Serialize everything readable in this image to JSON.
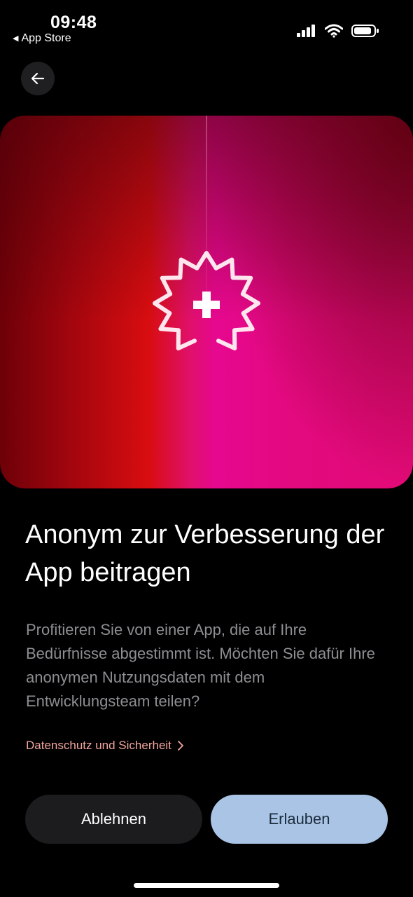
{
  "status_bar": {
    "time": "09:48",
    "back_to_app": "App Store"
  },
  "nav": {
    "back_icon": "arrow-left-icon"
  },
  "hero": {
    "icon": "seal-plus-icon",
    "colors": {
      "left": "#a5060e",
      "middle": "#e6088f",
      "right": "#e10a76"
    }
  },
  "content": {
    "title": "Anonym zur Verbesserung der App beitragen",
    "body": "Profitieren Sie von einer App, die auf Ihre Bedürfnisse abgestimmt ist. Möchten Sie dafür Ihre anonymen Nutzungsdaten mit dem Entwicklungsteam teilen?",
    "privacy_link": "Datenschutz und Sicherheit"
  },
  "actions": {
    "decline_label": "Ablehnen",
    "allow_label": "Erlauben"
  },
  "colors": {
    "allow_button": "#a9c4e5",
    "decline_button": "#1c1c1e",
    "link": "#f2a6a0"
  }
}
